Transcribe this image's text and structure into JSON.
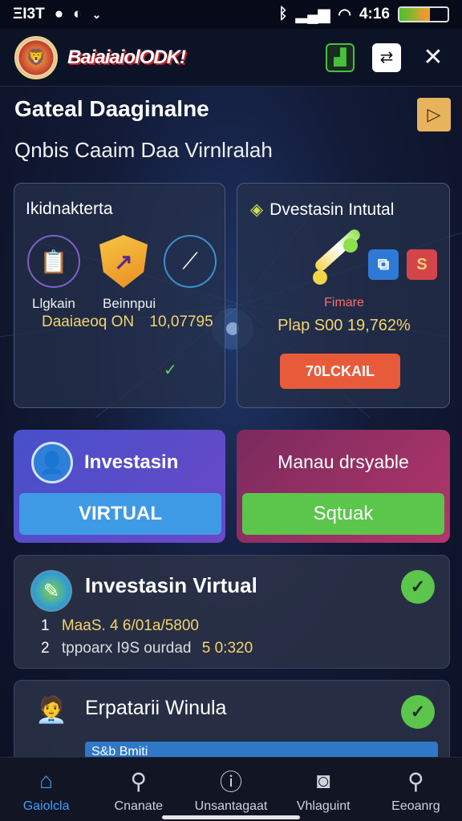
{
  "status_bar": {
    "left_text": "ΞΙ3Τ",
    "time": "4:16",
    "battery": "63",
    "battery_level": 0.63
  },
  "header": {
    "brand": "BaiaiaiolODK!",
    "actions": [
      "chart-icon",
      "sync-icon",
      "tools-icon"
    ]
  },
  "page": {
    "title": "Gateal Daaginalne",
    "subtitle": "Qnbis Caaim Daa Virnlralah"
  },
  "card_left": {
    "title": "Ikidnakterta",
    "label_1": "Llgkain",
    "label_2": "Beinnpui",
    "stat_a": "Daaiaeoq ON",
    "stat_b": "10,07795"
  },
  "card_right": {
    "title": "Dvestasin Intutal",
    "promo_label": "Fimare",
    "promo_value": "Plap S00 19,762%",
    "cta": "70LCKAIL"
  },
  "mid_left": {
    "title": "Investasin",
    "button": "VIRTUAL"
  },
  "mid_right": {
    "title": "Manau drsyable",
    "button": "Sqtuak"
  },
  "list_1": {
    "title": "Investasin Virtual",
    "row_1_num": "1",
    "row_1_text": "MaaS. 4 6/01a/5800",
    "row_2_num": "2",
    "row_2_text": "tppoarx I9S ourdad",
    "row_2_value": "5 0:320"
  },
  "list_2": {
    "title": "Erpatarii Winula",
    "strip_text": "S&b Bmiti"
  },
  "nav": {
    "items": [
      {
        "label": "Gaiolcla",
        "icon": "home-icon"
      },
      {
        "label": "Cnanate",
        "icon": "search-icon"
      },
      {
        "label": "Unsantagaat",
        "icon": "info-icon"
      },
      {
        "label": "Vhlaguint",
        "icon": "camera-icon"
      },
      {
        "label": "Eeoanrg",
        "icon": "search-icon"
      }
    ]
  },
  "colors": {
    "accent_blue": "#3aa3ff",
    "accent_green": "#5cc64c",
    "accent_orange": "#e85b3a",
    "accent_gold": "#f5d46c"
  }
}
